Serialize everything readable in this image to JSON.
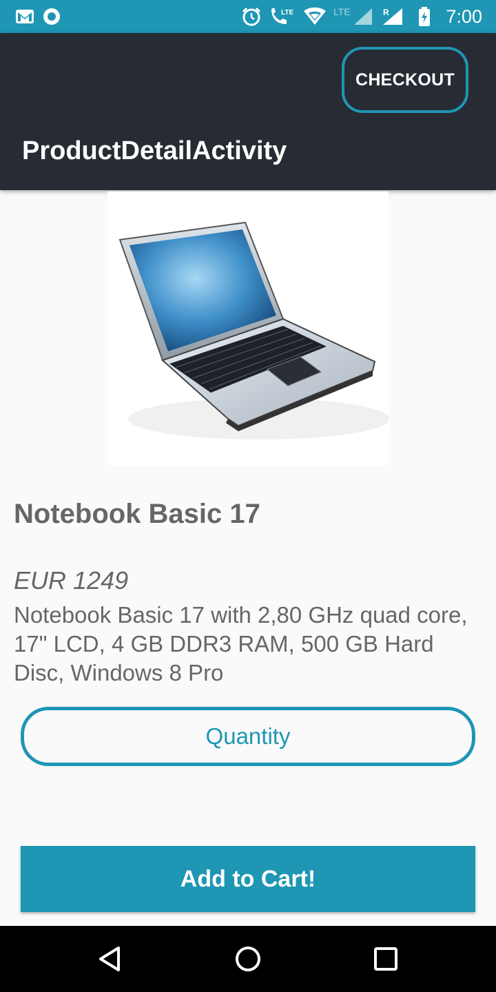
{
  "status_bar": {
    "time": "7:00",
    "icons": [
      "gmail-icon",
      "sync-icon",
      "alarm-icon",
      "lte-call-icon",
      "wifi-icon",
      "signal-icon",
      "roaming-signal-icon",
      "battery-charging-icon"
    ],
    "lte_label": "LTE",
    "roaming_label": "R"
  },
  "toolbar": {
    "checkout_label": "CHECKOUT",
    "title": "ProductDetailActivity"
  },
  "product": {
    "image": "laptop-image",
    "name": "Notebook Basic 17",
    "price": "EUR 1249",
    "description": "Notebook Basic 17 with 2,80 GHz quad core, 17\" LCD, 4 GB DDR3 RAM, 500 GB Hard Disc, Windows 8 Pro"
  },
  "form": {
    "quantity_placeholder": "Quantity",
    "add_to_cart_label": "Add to Cart!"
  },
  "nav": {
    "icons": [
      "back-icon",
      "home-icon",
      "recents-icon"
    ]
  },
  "colors": {
    "accent": "#1e96b4",
    "toolbar": "#272b33",
    "text": "#666666"
  }
}
